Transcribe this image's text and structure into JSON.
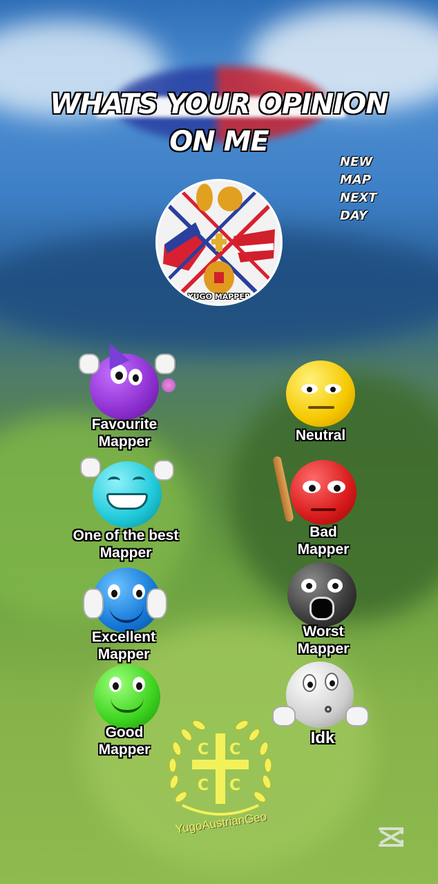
{
  "title": {
    "line1": "WHATS YOUR OPINION",
    "line2": "ON ME"
  },
  "side_note": {
    "line1": "NEW MAP",
    "line2": "NEXT DAY"
  },
  "logo": {
    "label": "YUGO MAPPER"
  },
  "options": {
    "favourite": {
      "line1": "Favourite",
      "line2": "Mapper",
      "color": "#8d2fd0"
    },
    "neutral": {
      "line1": "Neutral",
      "color": "#f5c800"
    },
    "one_of_best": {
      "line1": "One of the best",
      "line2": "Mapper",
      "color": "#1ec8d8"
    },
    "bad": {
      "line1": "Bad",
      "line2": "Mapper",
      "color": "#d81a1a"
    },
    "excellent": {
      "line1": "Excellent",
      "line2": "Mapper",
      "color": "#1478d8"
    },
    "worst": {
      "line1": "Worst",
      "line2": "Mapper",
      "color": "#3a3a3a"
    },
    "good": {
      "line1": "Good",
      "line2": "Mapper",
      "color": "#3cd21e"
    },
    "idk": {
      "line1": "Idk",
      "color": "#cfcfcf"
    }
  },
  "emblem": {
    "text": "YugoAustrianGeo",
    "color": "#f3f15a"
  },
  "watermark_icon": "capcut-icon"
}
